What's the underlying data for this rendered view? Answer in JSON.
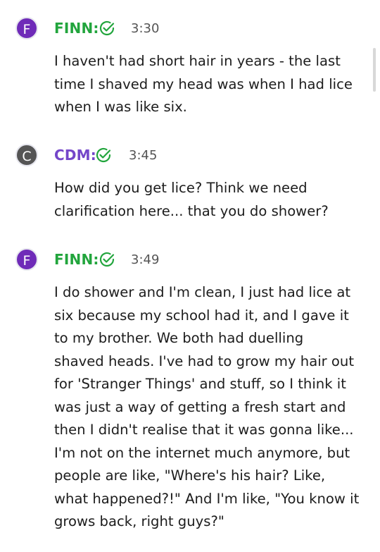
{
  "messages": [
    {
      "avatar_letter": "F",
      "speaker": "FINN:",
      "time": "3:30",
      "lines": [
        "I haven't had short hair in years - the last",
        "time I shaved my head was when I had lice",
        "when I was like six."
      ]
    },
    {
      "avatar_letter": "C",
      "speaker": "CDM:",
      "time": "3:45",
      "lines": [
        "How did you get lice? Think we need",
        "clarification here... that you do shower?"
      ]
    },
    {
      "avatar_letter": "F",
      "speaker": "FINN:",
      "time": "3:49",
      "lines": [
        "I do shower and I'm clean, I just had lice at",
        "six because my school had it, and I gave it",
        "to my brother. We both had duelling",
        "shaved heads. I've had to grow my hair out",
        "for 'Stranger Things' and stuff, so I think it",
        "was just a way of getting a fresh start and",
        "then I didn't realise that it was gonna like...",
        "I'm not on the internet much anymore, but",
        "people are like, \"Where's his hair? Like,",
        "what happened?!\" And I'm like, \"You know it",
        "grows back, right guys?\""
      ]
    }
  ],
  "colors": {
    "finn_name": "#22a53d",
    "cdm_name": "#7446c9",
    "finn_avatar": "#6f2bb8",
    "cdm_avatar": "#555555",
    "check": "#22a53d"
  },
  "icons": {
    "verified": "check-circle-icon"
  }
}
